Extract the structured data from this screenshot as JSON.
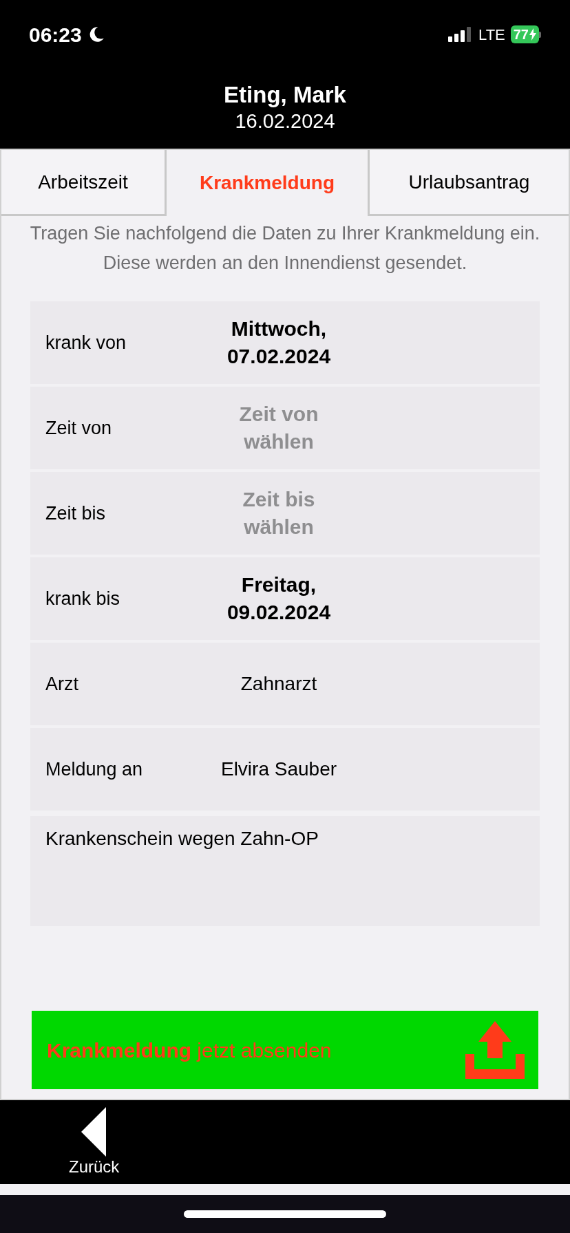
{
  "status_bar": {
    "time": "06:23",
    "network": "LTE",
    "battery": "77"
  },
  "header": {
    "name": "Eting, Mark",
    "date": "16.02.2024"
  },
  "tabs": [
    {
      "label": "Arbeitszeit",
      "selected": false
    },
    {
      "label": "Krankmeldung",
      "selected": true
    },
    {
      "label": "Urlaubsantrag",
      "selected": false
    }
  ],
  "intro": "Tragen Sie nachfolgend die Daten zu Ihrer Krankmeldung ein.\nDiese werden an den Innendienst gesendet.",
  "fields": [
    {
      "kind": "date",
      "label": "krank von",
      "value": "Mittwoch,\n07.02.2024"
    },
    {
      "kind": "time",
      "label": "Zeit von",
      "placeholder": "Zeit von\nwählen"
    },
    {
      "kind": "time",
      "label": "Zeit bis",
      "placeholder": "Zeit bis\nwählen"
    },
    {
      "kind": "date",
      "label": "krank bis",
      "value": "Freitag,\n09.02.2024"
    },
    {
      "kind": "text",
      "label": "Arzt",
      "value": "Zahnarzt"
    },
    {
      "kind": "text",
      "label": "Meldung an",
      "value": "Elvira Sauber"
    }
  ],
  "note": {
    "value": "Krankenschein wegen Zahn-OP"
  },
  "submit_button": {
    "label": "**Krankmeldung** jetzt absenden"
  },
  "back_button": {
    "label": "Zurück"
  }
}
